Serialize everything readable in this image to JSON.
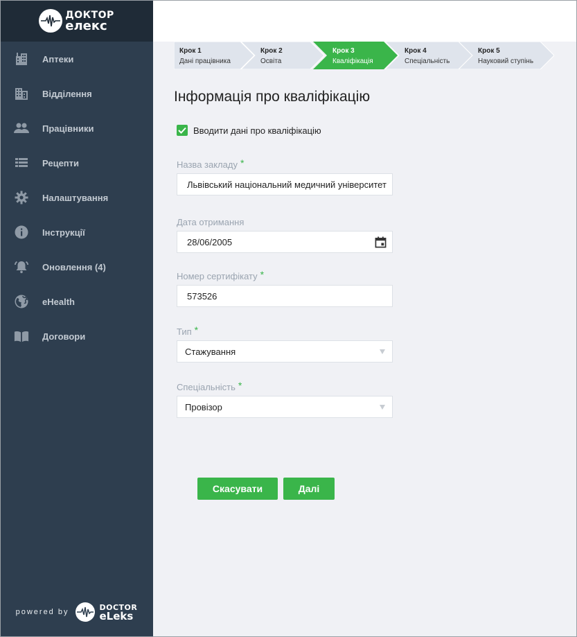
{
  "brand": {
    "logo_line1": "ДОКТОР",
    "logo_line2": "елекс",
    "powered_by": "powered by",
    "powered_line1": "DOCTOR",
    "powered_line2": "eLeks"
  },
  "sidebar": {
    "items": [
      {
        "label": "Аптеки",
        "icon": "pharmacy-building-icon"
      },
      {
        "label": "Відділення",
        "icon": "department-building-icon"
      },
      {
        "label": "Працівники",
        "icon": "people-icon"
      },
      {
        "label": "Рецепти",
        "icon": "list-icon"
      },
      {
        "label": "Налаштування",
        "icon": "gear-icon"
      },
      {
        "label": "Інструкції",
        "icon": "info-icon"
      },
      {
        "label": "Оновлення (4)",
        "icon": "bell-icon"
      },
      {
        "label": "eHealth",
        "icon": "globe-icon"
      },
      {
        "label": "Договори",
        "icon": "book-icon"
      }
    ]
  },
  "stepper": {
    "steps": [
      {
        "num": "Крок 1",
        "name": "Дані працівника",
        "active": false
      },
      {
        "num": "Крок 2",
        "name": "Освіта",
        "active": false
      },
      {
        "num": "Крок 3",
        "name": "Кваліфікація",
        "active": true
      },
      {
        "num": "Крок 4",
        "name": "Спеціальність",
        "active": false
      },
      {
        "num": "Крок 5",
        "name": "Науковий ступінь",
        "active": false
      }
    ]
  },
  "main": {
    "title": "Інформація про кваліфікацію",
    "checkbox_label": "Вводити дані про кваліфікацію",
    "checkbox_checked": true,
    "fields": {
      "institution": {
        "label": "Назва закладу",
        "required": "*",
        "value": "Львівський національний медичний університет"
      },
      "date": {
        "label": "Дата отримання",
        "value": "28/06/2005"
      },
      "certificate": {
        "label": "Номер сертифікату",
        "required": "*",
        "value": "573526"
      },
      "type": {
        "label": "Тип",
        "required": "*",
        "value": "Стажування"
      },
      "specialty": {
        "label": "Спеціальність",
        "required": "*",
        "value": "Провізор"
      }
    },
    "cancel_label": "Скасувати",
    "next_label": "Далі"
  },
  "colors": {
    "accent": "#3ab54a",
    "sidebar_bg": "#2e3e4f",
    "sidebar_header_bg": "#1f2b37",
    "step_inactive": "#dfe4ec",
    "page_bg": "#f0f1f5"
  }
}
